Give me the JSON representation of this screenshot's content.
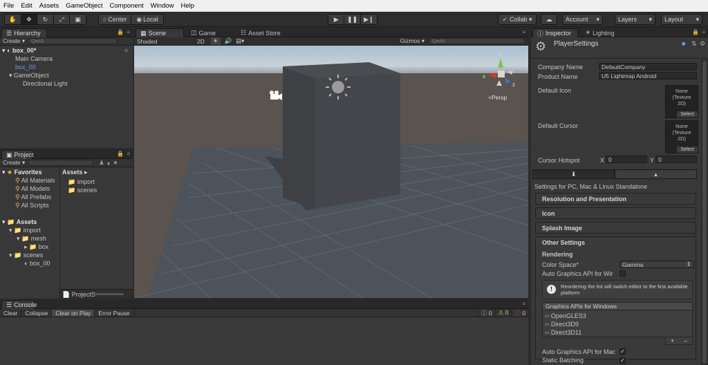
{
  "menu": [
    "File",
    "Edit",
    "Assets",
    "GameObject",
    "Component",
    "Window",
    "Help"
  ],
  "toolbar": {
    "pivot": "Center",
    "space": "Local",
    "collab": "Collab ▾",
    "account": "Account",
    "layers": "Layers",
    "layout": "Layout"
  },
  "hierarchy": {
    "tab": "Hierarchy",
    "create": "Create ▾",
    "search_placeholder": "Q▾All",
    "scene_name": "box_00*",
    "items": [
      "Main Camera",
      "box_00",
      "GameObject",
      "Directional Light"
    ]
  },
  "scene_tabs": [
    "Scene",
    "Game",
    "Asset Store"
  ],
  "scene_bar": {
    "shading": "Shaded",
    "mode2d": "2D",
    "gizmos": "Gizmos ▾",
    "search_placeholder": "Q▾All",
    "persp": "Persp"
  },
  "project": {
    "tab": "Project",
    "create": "Create ▾",
    "favorites_label": "Favorites",
    "favorites": [
      "All Materials",
      "All Models",
      "All Prefabs",
      "All Scripts"
    ],
    "assets_label": "Assets",
    "tree": [
      "import",
      "mesh",
      "box",
      "scenes",
      "box_00"
    ],
    "assets_header": "Assets ▸",
    "folders": [
      "import",
      "scenes"
    ],
    "footer": "ProjectS"
  },
  "console": {
    "tab": "Console",
    "buttons": [
      "Clear",
      "Collapse",
      "Clear on Play",
      "Error Pause"
    ],
    "counts": [
      "0",
      "0",
      "0"
    ]
  },
  "inspector": {
    "tabs": [
      "Inspector",
      "Lighting"
    ],
    "title": "PlayerSettings",
    "company_label": "Company Name",
    "company_value": "DefaultCompany",
    "product_label": "Product Name",
    "product_value": "U5 Lightmap Android",
    "default_icon_label": "Default Icon",
    "default_cursor_label": "Default Cursor",
    "texture_none": "None\n(Texture\n2D)",
    "select": "Select",
    "hotspot_label": "Cursor Hotspot",
    "hotspot_x_label": "X",
    "hotspot_x": "0",
    "hotspot_y_label": "Y",
    "hotspot_y": "0",
    "platform_title": "Settings for PC, Mac & Linux Standalone",
    "sections": [
      "Resolution and Presentation",
      "Icon",
      "Splash Image",
      "Other Settings"
    ],
    "rendering_label": "Rendering",
    "color_space_label": "Color Space*",
    "color_space_value": "Gamma",
    "auto_gfx_label": "Auto Graphics API for Wir",
    "info_text": "Reordering the list will switch editor to the first available platform",
    "gfx_header": "Graphics APIs for Windows",
    "gfx_apis": [
      "OpenGLES3",
      "Direct3D9",
      "Direct3D11"
    ],
    "auto_gfx_mac_label": "Auto Graphics API for Mac",
    "static_batching_label": "Static Batching"
  }
}
